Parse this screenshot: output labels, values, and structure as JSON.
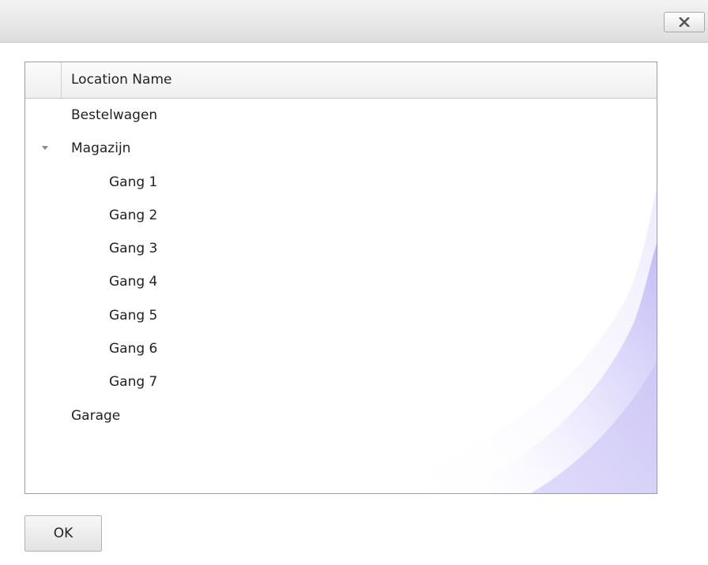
{
  "dialog": {
    "close_icon": "close-icon",
    "accent_color": "#c9c3f5"
  },
  "grid": {
    "header": {
      "column_name": "Location Name"
    },
    "rows": [
      {
        "label": "Bestelwagen",
        "level": 0,
        "expandable": false
      },
      {
        "label": "Magazijn",
        "level": 0,
        "expandable": true,
        "expanded": true
      },
      {
        "label": "Gang 1",
        "level": 1,
        "expandable": false
      },
      {
        "label": "Gang 2",
        "level": 1,
        "expandable": false
      },
      {
        "label": "Gang 3",
        "level": 1,
        "expandable": false
      },
      {
        "label": "Gang 4",
        "level": 1,
        "expandable": false
      },
      {
        "label": "Gang 5",
        "level": 1,
        "expandable": false
      },
      {
        "label": "Gang 6",
        "level": 1,
        "expandable": false
      },
      {
        "label": "Gang 7",
        "level": 1,
        "expandable": false
      },
      {
        "label": "Garage",
        "level": 0,
        "expandable": false
      }
    ]
  },
  "footer": {
    "ok_label": "OK"
  }
}
